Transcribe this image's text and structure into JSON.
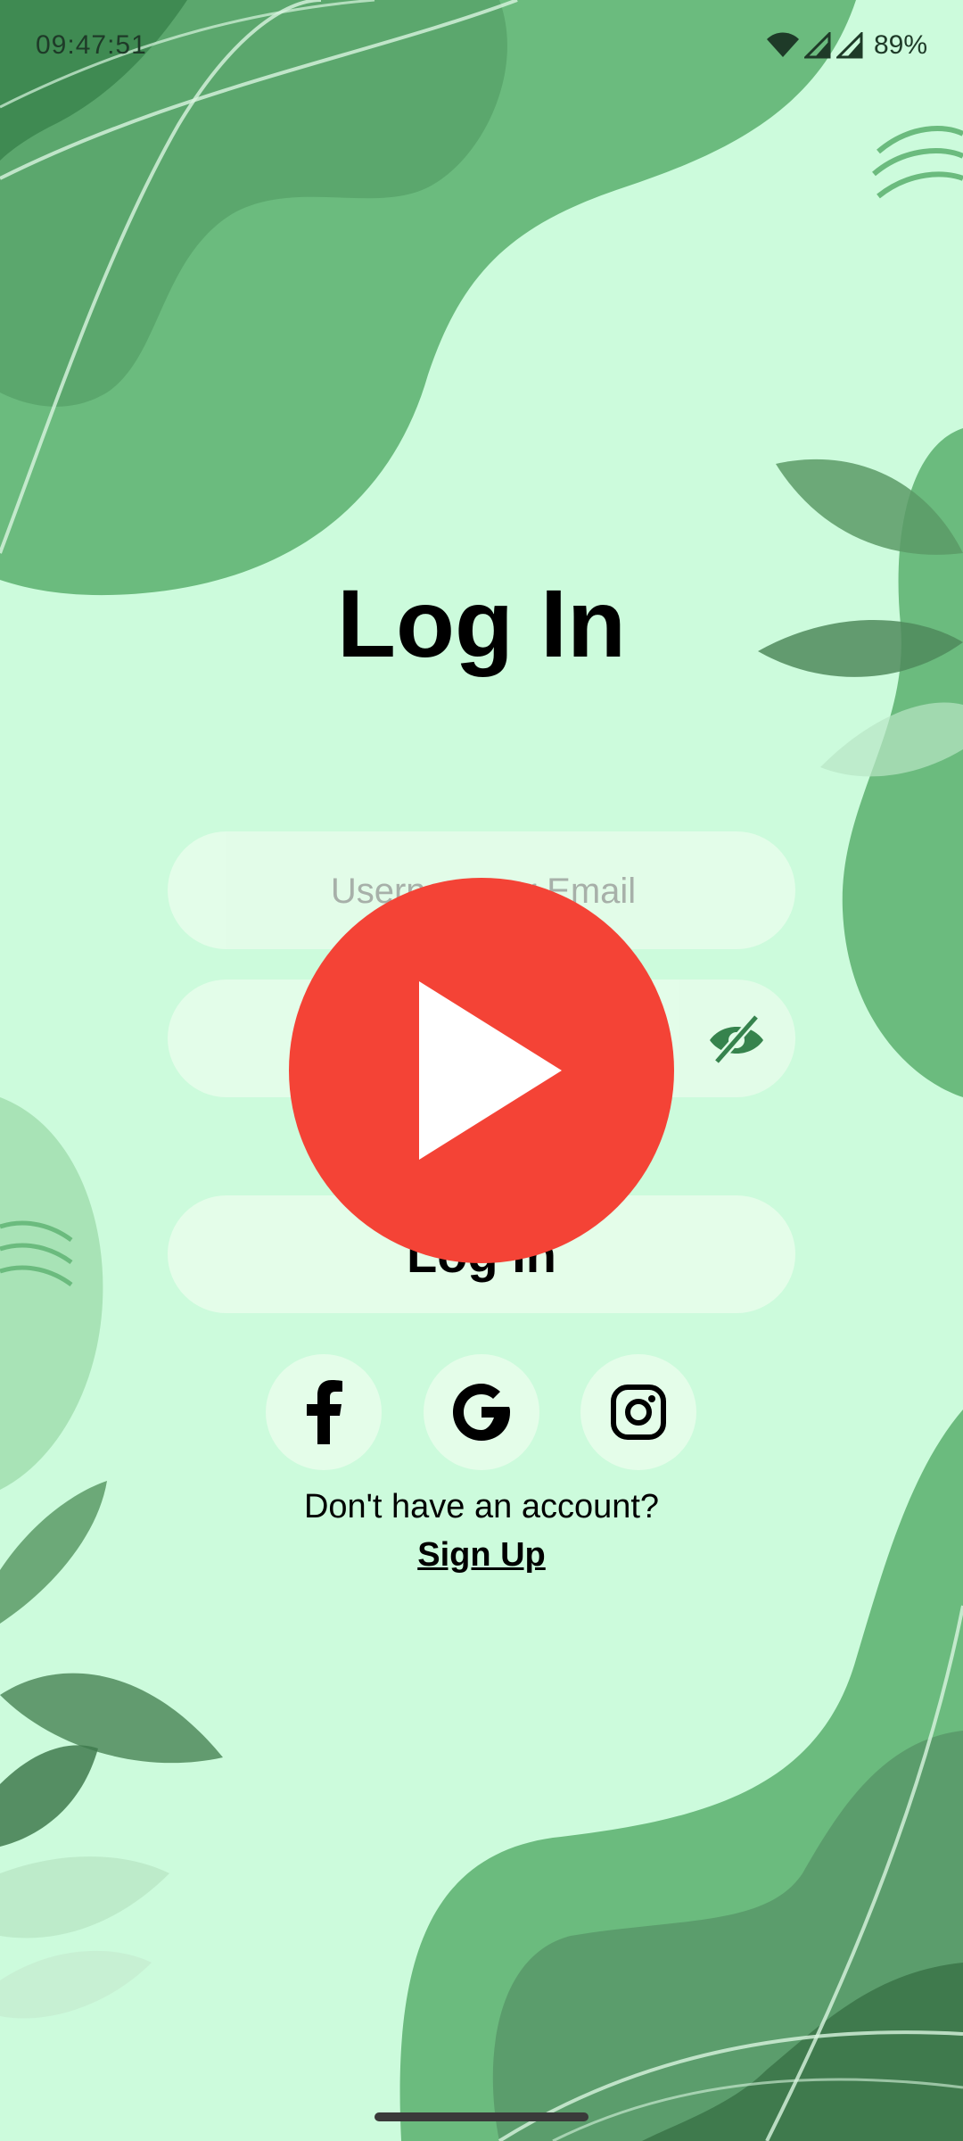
{
  "status_bar": {
    "time": "09:47:51",
    "battery": "89%",
    "icons": [
      "wifi-icon",
      "signal-icon",
      "signal-icon",
      "battery-text"
    ]
  },
  "login": {
    "title": "Log In",
    "username_placeholder": "Username or Email",
    "password_placeholder": "",
    "button_label": "Log In",
    "social": [
      "facebook-icon",
      "google-icon",
      "instagram-icon"
    ],
    "signup_prompt": "Don't have an account?",
    "signup_link": "Sign Up"
  },
  "overlay": {
    "icon": "play-icon",
    "color": "#f44336"
  },
  "colors": {
    "background": "#ccfbdc",
    "blob_dark": "#6bbb7e",
    "blob_darker": "#4f9a62",
    "field_bg": "#e4fde9",
    "eye_icon": "#2f7d46"
  }
}
